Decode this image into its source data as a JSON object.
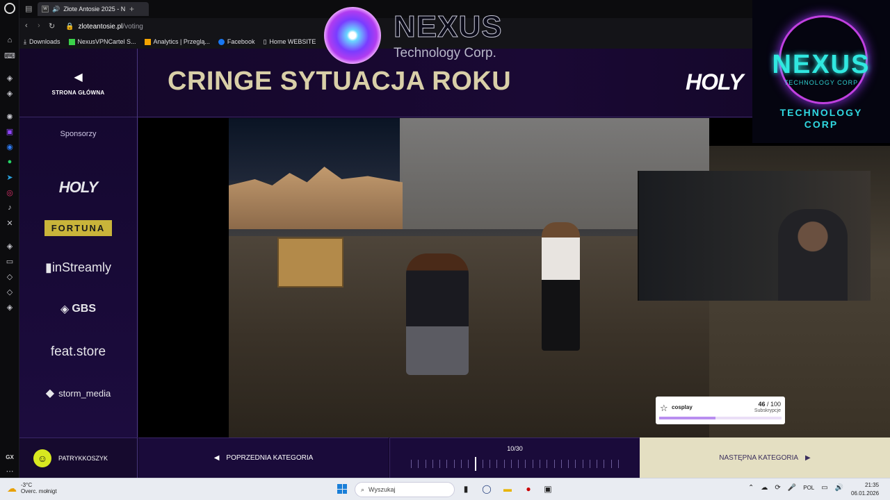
{
  "browser": {
    "tab_title": "Złote Antosie 2025 - N",
    "url_host": "zloteantosie.pl",
    "url_path": "/voting",
    "bookmarks": [
      "Downloads",
      "NexusVPNCartel S...",
      "Analytics | Przeglą...",
      "Facebook",
      "Home WEBSITE"
    ],
    "rail_label": "GX"
  },
  "site": {
    "home_label": "STRONA GŁÓWNA",
    "category_title": "CRINGE SYTUACJA ROKU",
    "header_sponsor": "HOLY",
    "sponsors_title": "Sponsorzy",
    "sponsors": [
      "HOLY",
      "FORTUNA",
      "inStreamly",
      "GBS",
      "feat.store",
      "storm_media"
    ],
    "username": "PATRYKKOSZYK",
    "prev_label": "POPRZEDNIA KATEGORIA",
    "next_label": "NASTĘPNA KATEGORIA",
    "progress_label": "10/30",
    "progress": {
      "current": 10,
      "total": 30
    }
  },
  "overlay": {
    "nexus_name": "NEXUS",
    "nexus_sub": "Technology Corp.",
    "corner_title": "NEXUS",
    "corner_sub1": "TECHNOLOGY CORP",
    "corner_sub2_a": "TECHNOLOGY",
    "corner_sub2_b": "CORP",
    "sub_goal_label": "cosplay",
    "sub_goal_current": "46",
    "sub_goal_total": "/ 100",
    "sub_goal_unit": "Subskrypcje",
    "sub_goal_fraction": 0.46
  },
  "taskbar": {
    "temp": "-3°C",
    "weather": "Overc. mołnigt",
    "search_placeholder": "Wyszukaj",
    "lang": "POL",
    "time": "21:35",
    "date": "06.01.2026"
  },
  "colors": {
    "accent": "#d9cfa8",
    "site_bg": "#100622",
    "next_bg": "#e4dfc2",
    "avatar": "#d8e820"
  }
}
